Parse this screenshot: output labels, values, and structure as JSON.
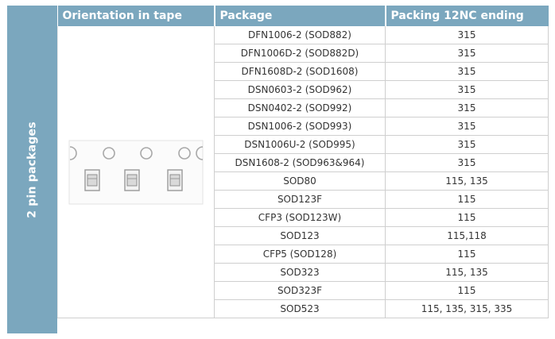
{
  "sidebar": {
    "label": "2 pin packages"
  },
  "header": {
    "col1": "Orientation in tape",
    "col2": "Package",
    "col3": "Packing 12NC ending"
  },
  "colors": {
    "header_bg": "#7ba7be",
    "header_text": "#ffffff",
    "grid": "#cfcfcf"
  },
  "illustration": {
    "icon": "tape-reel-orientation-icon"
  },
  "rows": [
    {
      "package": "DFN1006-2 (SOD882)",
      "packing": "315"
    },
    {
      "package": "DFN1006D-2 (SOD882D)",
      "packing": "315"
    },
    {
      "package": "DFN1608D-2 (SOD1608)",
      "packing": "315"
    },
    {
      "package": "DSN0603-2 (SOD962)",
      "packing": "315"
    },
    {
      "package": "DSN0402-2 (SOD992)",
      "packing": "315"
    },
    {
      "package": "DSN1006-2 (SOD993)",
      "packing": "315"
    },
    {
      "package": "DSN1006U-2 (SOD995)",
      "packing": "315"
    },
    {
      "package": "DSN1608-2 (SOD963&964)",
      "packing": "315"
    },
    {
      "package": "SOD80",
      "packing": "115, 135"
    },
    {
      "package": "SOD123F",
      "packing": "115"
    },
    {
      "package": "CFP3 (SOD123W)",
      "packing": "115"
    },
    {
      "package": "SOD123",
      "packing": "115,118"
    },
    {
      "package": "CFP5 (SOD128)",
      "packing": "115"
    },
    {
      "package": "SOD323",
      "packing": "115, 135"
    },
    {
      "package": "SOD323F",
      "packing": "115"
    },
    {
      "package": "SOD523",
      "packing": "115, 135, 315, 335"
    }
  ]
}
